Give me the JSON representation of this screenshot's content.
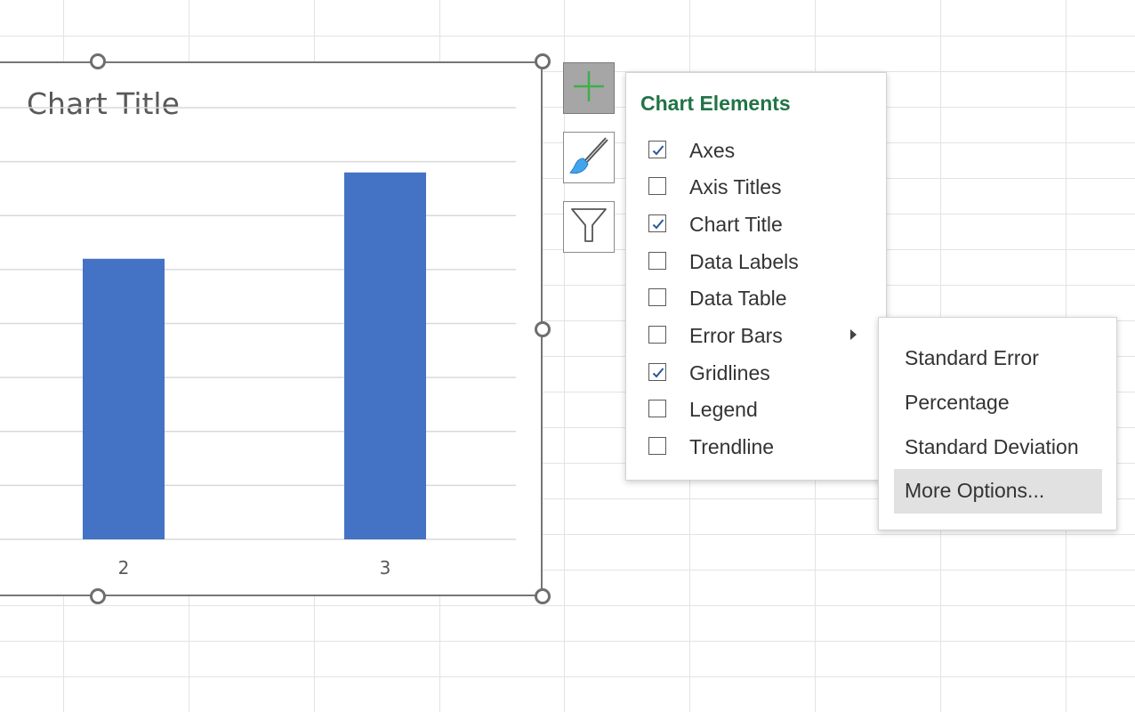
{
  "chart": {
    "title": "Chart Title"
  },
  "chart_data": {
    "type": "bar",
    "title": "Chart Title",
    "categories": [
      "2",
      "3"
    ],
    "values": [
      52,
      68
    ],
    "ylim": [
      0,
      80
    ],
    "grid": true,
    "color": "#4472C4"
  },
  "side_buttons": {
    "elements_icon": "plus-icon",
    "styles_icon": "paintbrush-icon",
    "filters_icon": "filter-icon"
  },
  "chart_elements": {
    "title": "Chart Elements",
    "items": [
      {
        "label": "Axes",
        "checked": true
      },
      {
        "label": "Axis Titles",
        "checked": false
      },
      {
        "label": "Chart Title",
        "checked": true
      },
      {
        "label": "Data Labels",
        "checked": false
      },
      {
        "label": "Data Table",
        "checked": false
      },
      {
        "label": "Error Bars",
        "checked": false,
        "submenu": true
      },
      {
        "label": "Gridlines",
        "checked": true
      },
      {
        "label": "Legend",
        "checked": false
      },
      {
        "label": "Trendline",
        "checked": false
      }
    ]
  },
  "error_bars_menu": {
    "items": [
      {
        "label": "Standard Error"
      },
      {
        "label": "Percentage"
      },
      {
        "label": "Standard Deviation"
      },
      {
        "label": "More Options..."
      }
    ],
    "highlighted": "More Options..."
  },
  "colors": {
    "accent": "#217346",
    "bar": "#4472C4",
    "active_button": "#A6A6A6",
    "plus": "#3FAF4B"
  }
}
